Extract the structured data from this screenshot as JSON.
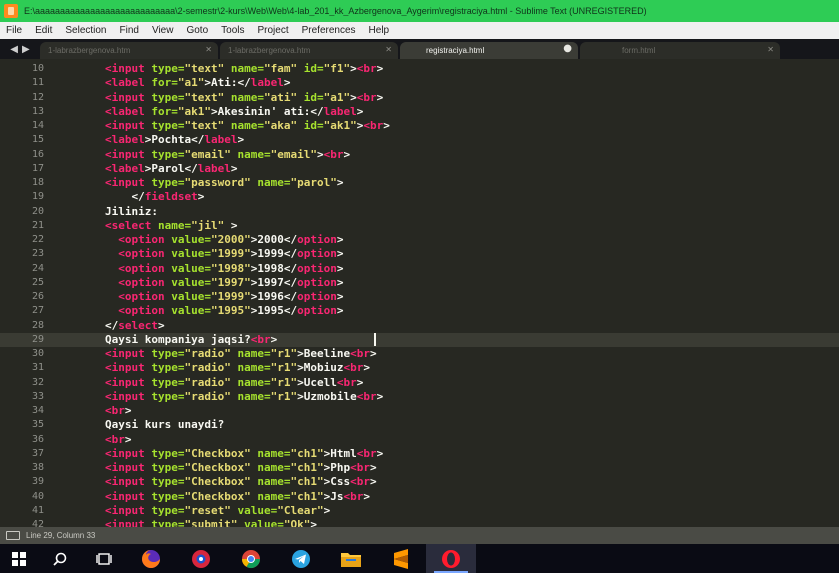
{
  "window": {
    "title": "E:\\aaaaaaaaaaaaaaaaaaaaaaaaaaaa\\2-semestr\\2-kurs\\Web\\Web\\4-lab_201_kk_Azbergenova_Aygerim\\registraciya.html - Sublime Text (UNREGISTERED)"
  },
  "menu": [
    "File",
    "Edit",
    "Selection",
    "Find",
    "View",
    "Goto",
    "Tools",
    "Project",
    "Preferences",
    "Help"
  ],
  "tabs": [
    {
      "label": "1-labrazbergenova.htm",
      "active": false
    },
    {
      "label": "1-labrazbergenova.htm",
      "active": false
    },
    {
      "label": "registraciya.html",
      "active": true
    },
    {
      "label": "form.html",
      "active": false
    }
  ],
  "editor": {
    "lines": [
      {
        "n": "10",
        "parts": [
          [
            "tg",
            "<input"
          ],
          [
            "at",
            " type="
          ],
          [
            "st",
            "\"text\""
          ],
          [
            "at",
            " name="
          ],
          [
            "st",
            "\"fam\""
          ],
          [
            "at",
            " id="
          ],
          [
            "st",
            "\"f1\""
          ],
          [
            "tx",
            ">"
          ],
          [
            "tg",
            "<br"
          ],
          [
            "tx",
            ">"
          ]
        ]
      },
      {
        "n": "11",
        "parts": [
          [
            "tg",
            "<label"
          ],
          [
            "at",
            " for="
          ],
          [
            "st",
            "\"a1\""
          ],
          [
            "tx",
            ">Ati:</"
          ],
          [
            "tg",
            "label"
          ],
          [
            "tx",
            ">"
          ]
        ]
      },
      {
        "n": "12",
        "parts": [
          [
            "tg",
            "<input"
          ],
          [
            "at",
            " type="
          ],
          [
            "st",
            "\"text\""
          ],
          [
            "at",
            " name="
          ],
          [
            "st",
            "\"ati\""
          ],
          [
            "at",
            " id="
          ],
          [
            "st",
            "\"a1\""
          ],
          [
            "tx",
            ">"
          ],
          [
            "tg",
            "<br"
          ],
          [
            "tx",
            ">"
          ]
        ]
      },
      {
        "n": "13",
        "parts": [
          [
            "tg",
            "<label"
          ],
          [
            "at",
            " for="
          ],
          [
            "st",
            "\"ak1\""
          ],
          [
            "tx",
            ">Akesinin' ati:</"
          ],
          [
            "tg",
            "label"
          ],
          [
            "tx",
            ">"
          ]
        ]
      },
      {
        "n": "14",
        "parts": [
          [
            "tg",
            "<input"
          ],
          [
            "at",
            " type="
          ],
          [
            "st",
            "\"text\""
          ],
          [
            "at",
            " name="
          ],
          [
            "st",
            "\"aka\""
          ],
          [
            "at",
            " id="
          ],
          [
            "st",
            "\"ak1\""
          ],
          [
            "tx",
            ">"
          ],
          [
            "tg",
            "<br"
          ],
          [
            "tx",
            ">"
          ]
        ]
      },
      {
        "n": "15",
        "parts": [
          [
            "tg",
            "<label"
          ],
          [
            "tx",
            ">Pochta</"
          ],
          [
            "tg",
            "label"
          ],
          [
            "tx",
            ">"
          ]
        ]
      },
      {
        "n": "16",
        "parts": [
          [
            "tg",
            "<input"
          ],
          [
            "at",
            " type="
          ],
          [
            "st",
            "\"email\""
          ],
          [
            "at",
            " name="
          ],
          [
            "st",
            "\"email\""
          ],
          [
            "tx",
            ">"
          ],
          [
            "tg",
            "<br"
          ],
          [
            "tx",
            ">"
          ]
        ]
      },
      {
        "n": "17",
        "parts": [
          [
            "tg",
            "<label"
          ],
          [
            "tx",
            ">Parol</"
          ],
          [
            "tg",
            "label"
          ],
          [
            "tx",
            ">"
          ]
        ]
      },
      {
        "n": "18",
        "parts": [
          [
            "tg",
            "<input"
          ],
          [
            "at",
            " type="
          ],
          [
            "st",
            "\"password\""
          ],
          [
            "at",
            " name="
          ],
          [
            "st",
            "\"parol\""
          ],
          [
            "tx",
            ">"
          ]
        ]
      },
      {
        "n": "19",
        "parts": [
          [
            "tx",
            "    </"
          ],
          [
            "tg",
            "fieldset"
          ],
          [
            "tx",
            ">"
          ]
        ]
      },
      {
        "n": "20",
        "parts": [
          [
            "tx",
            "Jiliniz:"
          ]
        ]
      },
      {
        "n": "21",
        "parts": [
          [
            "tg",
            "<select"
          ],
          [
            "at",
            " name="
          ],
          [
            "st",
            "\"jil\""
          ],
          [
            "tx",
            " >"
          ]
        ]
      },
      {
        "n": "22",
        "parts": [
          [
            "tx",
            "  "
          ],
          [
            "tg",
            "<option"
          ],
          [
            "at",
            " value="
          ],
          [
            "st",
            "\"2000\""
          ],
          [
            "tx",
            ">2000</"
          ],
          [
            "tg",
            "option"
          ],
          [
            "tx",
            ">"
          ]
        ]
      },
      {
        "n": "23",
        "parts": [
          [
            "tx",
            "  "
          ],
          [
            "tg",
            "<option"
          ],
          [
            "at",
            " value="
          ],
          [
            "st",
            "\"1999\""
          ],
          [
            "tx",
            ">1999</"
          ],
          [
            "tg",
            "option"
          ],
          [
            "tx",
            ">"
          ]
        ]
      },
      {
        "n": "24",
        "parts": [
          [
            "tx",
            "  "
          ],
          [
            "tg",
            "<option"
          ],
          [
            "at",
            " value="
          ],
          [
            "st",
            "\"1998\""
          ],
          [
            "tx",
            ">1998</"
          ],
          [
            "tg",
            "option"
          ],
          [
            "tx",
            ">"
          ]
        ]
      },
      {
        "n": "25",
        "parts": [
          [
            "tx",
            "  "
          ],
          [
            "tg",
            "<option"
          ],
          [
            "at",
            " value="
          ],
          [
            "st",
            "\"1997\""
          ],
          [
            "tx",
            ">1997</"
          ],
          [
            "tg",
            "option"
          ],
          [
            "tx",
            ">"
          ]
        ]
      },
      {
        "n": "26",
        "parts": [
          [
            "tx",
            "  "
          ],
          [
            "tg",
            "<option"
          ],
          [
            "at",
            " value="
          ],
          [
            "st",
            "\"1999\""
          ],
          [
            "tx",
            ">1996</"
          ],
          [
            "tg",
            "option"
          ],
          [
            "tx",
            ">"
          ]
        ]
      },
      {
        "n": "27",
        "parts": [
          [
            "tx",
            "  "
          ],
          [
            "tg",
            "<option"
          ],
          [
            "at",
            " value="
          ],
          [
            "st",
            "\"1995\""
          ],
          [
            "tx",
            ">1995</"
          ],
          [
            "tg",
            "option"
          ],
          [
            "tx",
            ">"
          ]
        ]
      },
      {
        "n": "28",
        "parts": [
          [
            "tx",
            "</"
          ],
          [
            "tg",
            "select"
          ],
          [
            "tx",
            ">"
          ]
        ]
      },
      {
        "n": "29",
        "parts": [
          [
            "tx",
            "Qaysi kompaniya jaqsi?"
          ],
          [
            "tg",
            "<br"
          ],
          [
            "tx",
            ">"
          ]
        ],
        "current": true
      },
      {
        "n": "30",
        "parts": [
          [
            "tg",
            "<input"
          ],
          [
            "at",
            " type="
          ],
          [
            "st",
            "\"radio\""
          ],
          [
            "at",
            " name="
          ],
          [
            "st",
            "\"r1\""
          ],
          [
            "tx",
            ">Beeline"
          ],
          [
            "tg",
            "<br"
          ],
          [
            "tx",
            ">"
          ]
        ]
      },
      {
        "n": "31",
        "parts": [
          [
            "tg",
            "<input"
          ],
          [
            "at",
            " type="
          ],
          [
            "st",
            "\"radio\""
          ],
          [
            "at",
            " name="
          ],
          [
            "st",
            "\"r1\""
          ],
          [
            "tx",
            ">Mobiuz"
          ],
          [
            "tg",
            "<br"
          ],
          [
            "tx",
            ">"
          ]
        ]
      },
      {
        "n": "32",
        "parts": [
          [
            "tg",
            "<input"
          ],
          [
            "at",
            " type="
          ],
          [
            "st",
            "\"radio\""
          ],
          [
            "at",
            " name="
          ],
          [
            "st",
            "\"r1\""
          ],
          [
            "tx",
            ">Ucell"
          ],
          [
            "tg",
            "<br"
          ],
          [
            "tx",
            ">"
          ]
        ]
      },
      {
        "n": "33",
        "parts": [
          [
            "tg",
            "<input"
          ],
          [
            "at",
            " type="
          ],
          [
            "st",
            "\"radio\""
          ],
          [
            "at",
            " name="
          ],
          [
            "st",
            "\"r1\""
          ],
          [
            "tx",
            ">Uzmobile"
          ],
          [
            "tg",
            "<br"
          ],
          [
            "tx",
            ">"
          ]
        ]
      },
      {
        "n": "34",
        "parts": [
          [
            "tg",
            "<br"
          ],
          [
            "tx",
            ">"
          ]
        ]
      },
      {
        "n": "35",
        "parts": [
          [
            "tx",
            "Qaysi kurs unaydi?"
          ]
        ]
      },
      {
        "n": "36",
        "parts": [
          [
            "tg",
            "<br"
          ],
          [
            "tx",
            ">"
          ]
        ]
      },
      {
        "n": "37",
        "parts": [
          [
            "tg",
            "<input"
          ],
          [
            "at",
            " type="
          ],
          [
            "st",
            "\"Checkbox\""
          ],
          [
            "at",
            " name="
          ],
          [
            "st",
            "\"ch1\""
          ],
          [
            "tx",
            ">Html"
          ],
          [
            "tg",
            "<br"
          ],
          [
            "tx",
            ">"
          ]
        ]
      },
      {
        "n": "38",
        "parts": [
          [
            "tg",
            "<input"
          ],
          [
            "at",
            " type="
          ],
          [
            "st",
            "\"Checkbox\""
          ],
          [
            "at",
            " name="
          ],
          [
            "st",
            "\"ch1\""
          ],
          [
            "tx",
            ">Php"
          ],
          [
            "tg",
            "<br"
          ],
          [
            "tx",
            ">"
          ]
        ]
      },
      {
        "n": "39",
        "parts": [
          [
            "tg",
            "<input"
          ],
          [
            "at",
            " type="
          ],
          [
            "st",
            "\"Checkbox\""
          ],
          [
            "at",
            " name="
          ],
          [
            "st",
            "\"ch1\""
          ],
          [
            "tx",
            ">Css"
          ],
          [
            "tg",
            "<br"
          ],
          [
            "tx",
            ">"
          ]
        ]
      },
      {
        "n": "40",
        "parts": [
          [
            "tg",
            "<input"
          ],
          [
            "at",
            " type="
          ],
          [
            "st",
            "\"Checkbox\""
          ],
          [
            "at",
            " name="
          ],
          [
            "st",
            "\"ch1\""
          ],
          [
            "tx",
            ">Js"
          ],
          [
            "tg",
            "<br"
          ],
          [
            "tx",
            ">"
          ]
        ]
      },
      {
        "n": "41",
        "parts": [
          [
            "tg",
            "<input"
          ],
          [
            "at",
            " type="
          ],
          [
            "st",
            "\"reset\""
          ],
          [
            "at",
            " value="
          ],
          [
            "st",
            "\"Clear\""
          ],
          [
            "tx",
            ">"
          ]
        ]
      },
      {
        "n": "42",
        "parts": [
          [
            "tg",
            "<input"
          ],
          [
            "at",
            " type="
          ],
          [
            "st",
            "\"submit\""
          ],
          [
            "at",
            " value="
          ],
          [
            "st",
            "\"Ok\""
          ],
          [
            "tx",
            ">"
          ]
        ]
      }
    ]
  },
  "status": {
    "position": "Line 29, Column 33"
  },
  "taskbar": {
    "items": [
      {
        "name": "windows-start-icon",
        "color": "#ffffff"
      },
      {
        "name": "search-icon",
        "color": "#ffffff"
      },
      {
        "name": "task-view-icon",
        "color": "#ffffff"
      },
      {
        "name": "firefox-icon",
        "color": "#ff7a1a"
      },
      {
        "name": "yandex-browser-icon",
        "color": "#d7263d"
      },
      {
        "name": "chrome-icon",
        "color": "#4285f4"
      },
      {
        "name": "telegram-icon",
        "color": "#2aa3e0"
      },
      {
        "name": "file-explorer-icon",
        "color": "#ffc83d"
      },
      {
        "name": "sublime-text-icon",
        "color": "#ff9800"
      },
      {
        "name": "opera-icon",
        "color": "#ff1b2d"
      }
    ],
    "active": "opera-icon"
  },
  "colors": {
    "titlebar": "#2ecc55",
    "editor_bg": "#272822",
    "tag": "#f92672",
    "attribute": "#a6e22e",
    "string": "#e6db74",
    "text": "#f8f8f2"
  }
}
